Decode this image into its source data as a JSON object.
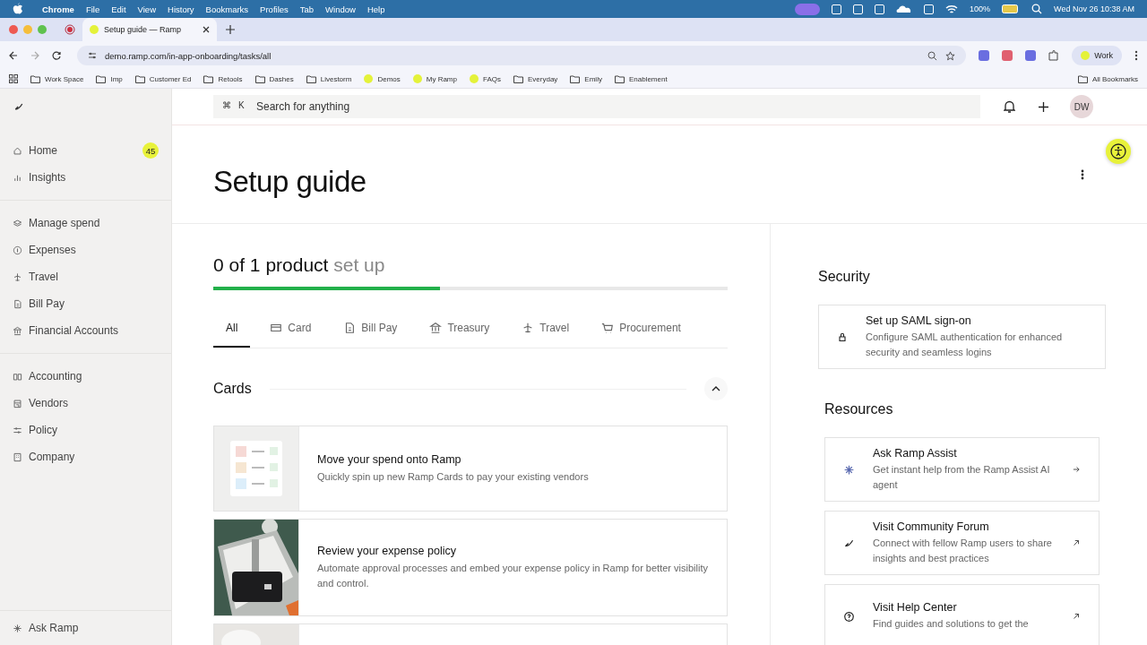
{
  "menu_bar": {
    "app": "Chrome",
    "items": [
      "File",
      "Edit",
      "View",
      "History",
      "Bookmarks",
      "Profiles",
      "Tab",
      "Window",
      "Help"
    ],
    "battery": "100%",
    "datetime": "Wed Nov 26  10:38 AM"
  },
  "browser": {
    "tab_title": "Setup guide — Ramp",
    "url": "demo.ramp.com/in-app-onboarding/tasks/all",
    "profile": "Work",
    "bookmarks": [
      {
        "label": "Work Space",
        "kind": "folder"
      },
      {
        "label": "Imp",
        "kind": "folder"
      },
      {
        "label": "Customer Ed",
        "kind": "folder"
      },
      {
        "label": "Retools",
        "kind": "folder"
      },
      {
        "label": "Dashes",
        "kind": "folder"
      },
      {
        "label": "Livestorm",
        "kind": "folder"
      },
      {
        "label": "Demos",
        "kind": "site"
      },
      {
        "label": "My Ramp",
        "kind": "site"
      },
      {
        "label": "FAQs",
        "kind": "site"
      },
      {
        "label": "Everyday",
        "kind": "folder"
      },
      {
        "label": "Emily",
        "kind": "folder"
      },
      {
        "label": "Enablement",
        "kind": "folder"
      }
    ],
    "all_bookmarks": "All Bookmarks"
  },
  "sidebar": {
    "groups": [
      [
        {
          "label": "Home",
          "badge": "45"
        },
        {
          "label": "Insights"
        }
      ],
      [
        {
          "label": "Manage spend"
        },
        {
          "label": "Expenses"
        },
        {
          "label": "Travel"
        },
        {
          "label": "Bill Pay"
        },
        {
          "label": "Financial Accounts"
        }
      ],
      [
        {
          "label": "Accounting"
        },
        {
          "label": "Vendors"
        },
        {
          "label": "Policy"
        },
        {
          "label": "Company"
        }
      ]
    ],
    "footer": "Ask Ramp"
  },
  "topbar": {
    "shortcut": [
      "⌘",
      "K"
    ],
    "placeholder": "Search for anything",
    "avatar": "DW"
  },
  "title": "Setup guide",
  "progress": {
    "done": "0 of 1 product",
    "rest": "set up",
    "level": 0.44
  },
  "tabs": [
    {
      "label": "All",
      "selected": true
    },
    {
      "label": "Card",
      "selected": false
    },
    {
      "label": "Bill Pay",
      "selected": false
    },
    {
      "label": "Treasury",
      "selected": false
    },
    {
      "label": "Travel",
      "selected": false
    },
    {
      "label": "Procurement",
      "selected": false
    }
  ],
  "section": {
    "title": "Cards",
    "expanded": true
  },
  "tasks": [
    {
      "title": "Move your spend onto Ramp",
      "description": "Quickly spin up new Ramp Cards to pay your existing vendors"
    },
    {
      "title": "Review your expense policy",
      "description": "Automate approval processes and embed your expense policy in Ramp for better visibility and control.",
      "kind": "picture"
    },
    {
      "kind": "picture"
    }
  ],
  "security": {
    "title": "Security",
    "items": [
      {
        "title": "Set up SAML sign-on",
        "description": "Configure SAML authentication for enhanced security and seamless logins"
      }
    ]
  },
  "resources": {
    "title": "Resources",
    "items": [
      {
        "title": "Ask Ramp Assist",
        "description": "Get instant help from the Ramp Assist AI agent"
      },
      {
        "title": "Visit Community Forum",
        "description": "Connect with fellow Ramp users to share insights and best practices"
      },
      {
        "title": "Visit Help Center",
        "description": "Find guides and solutions to get the"
      }
    ]
  }
}
